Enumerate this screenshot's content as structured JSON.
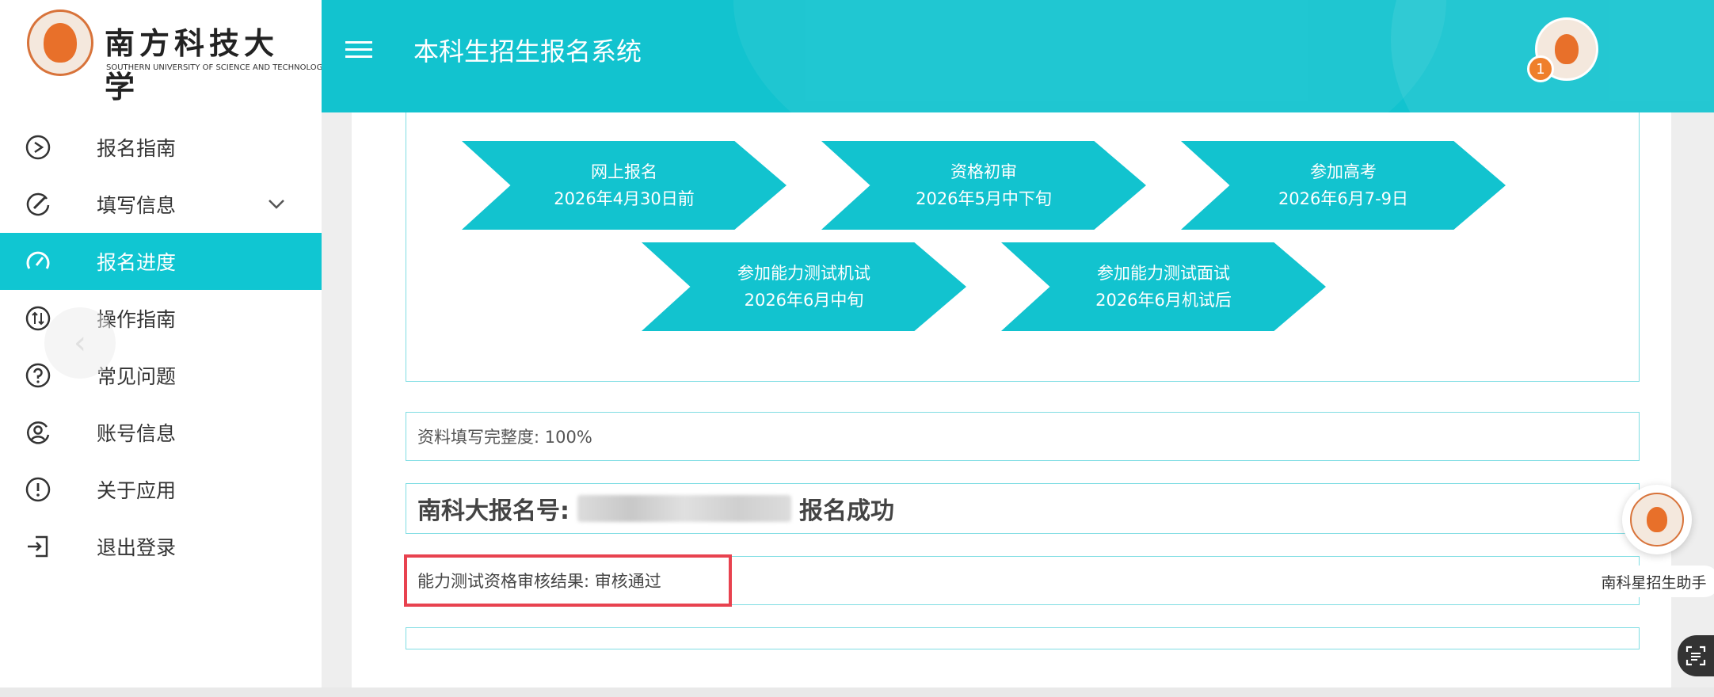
{
  "brand": {
    "name_cn": "南方科技大学",
    "name_en": "SOUTHERN UNIVERSITY OF SCIENCE AND TECHNOLOGY"
  },
  "header": {
    "title": "本科生招生报名系统",
    "badge_count": "1"
  },
  "sidebar": {
    "items": [
      {
        "label": "报名指南",
        "icon": "play-circle-icon"
      },
      {
        "label": "填写信息",
        "icon": "edit-icon"
      },
      {
        "label": "报名进度",
        "icon": "dashboard-icon"
      },
      {
        "label": "操作指南",
        "icon": "swap-circle-icon"
      },
      {
        "label": "常见问题",
        "icon": "question-circle-icon"
      },
      {
        "label": "账号信息",
        "icon": "user-circle-icon"
      },
      {
        "label": "关于应用",
        "icon": "info-circle-icon"
      },
      {
        "label": "退出登录",
        "icon": "logout-icon"
      }
    ],
    "active_index": 2
  },
  "steps": [
    {
      "title": "网上报名",
      "date": "2026年4月30日前"
    },
    {
      "title": "资格初审",
      "date": "2026年5月中下旬"
    },
    {
      "title": "参加高考",
      "date": "2026年6月7-9日"
    },
    {
      "title": "参加能力测试机试",
      "date": "2026年6月中旬"
    },
    {
      "title": "参加能力测试面试",
      "date": "2026年6月机试后"
    }
  ],
  "completeness": {
    "text": "资料填写完整度: 100%"
  },
  "registration": {
    "label": "南科大报名号:",
    "status": "报名成功"
  },
  "audit": {
    "text": "能力测试资格审核结果: 审核通过"
  },
  "assistant": {
    "label": "南科星招生助手"
  },
  "colors": {
    "accent": "#12c3cf",
    "highlight": "#e8424f",
    "badge": "#ef7f2b"
  }
}
